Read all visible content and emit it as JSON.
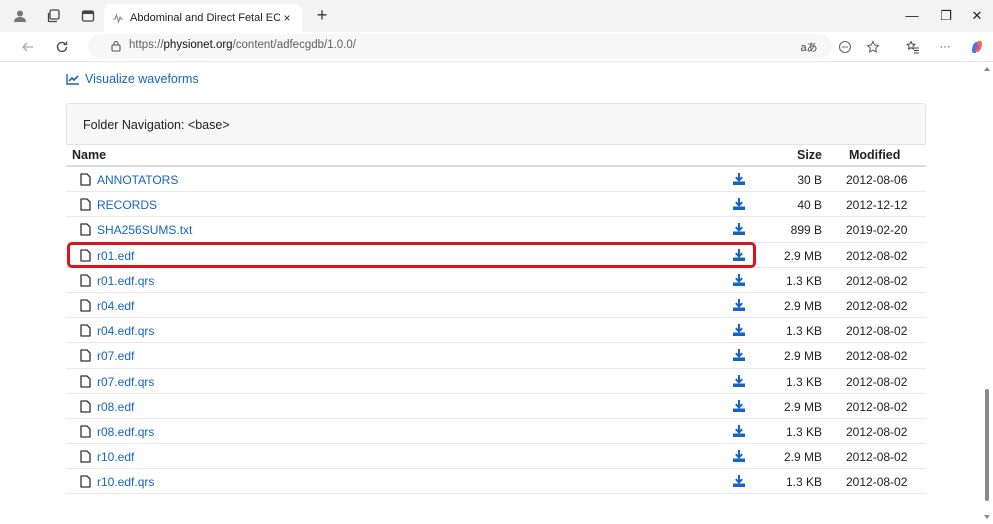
{
  "browser": {
    "tab_title": "Abdominal and Direct Fetal ECG D",
    "tab_close": "×",
    "new_tab": "+",
    "url_prefix": "https://",
    "url_host": "physionet.org",
    "url_path": "/content/adfecgdb/1.0.0/",
    "read_aloud": "aあ",
    "more": "···",
    "win_min": "—",
    "win_restore": "❐",
    "win_close": "✕"
  },
  "page": {
    "visualize_link": "Visualize waveforms",
    "folder_nav": "Folder Navigation: <base>",
    "columns": {
      "name": "Name",
      "size": "Size",
      "modified": "Modified"
    },
    "files": [
      {
        "name": "ANNOTATORS",
        "size": "30 B",
        "modified": "2012-08-06"
      },
      {
        "name": "RECORDS",
        "size": "40 B",
        "modified": "2012-12-12"
      },
      {
        "name": "SHA256SUMS.txt",
        "size": "899 B",
        "modified": "2019-02-20"
      },
      {
        "name": "r01.edf",
        "size": "2.9 MB",
        "modified": "2012-08-02"
      },
      {
        "name": "r01.edf.qrs",
        "size": "1.3 KB",
        "modified": "2012-08-02"
      },
      {
        "name": "r04.edf",
        "size": "2.9 MB",
        "modified": "2012-08-02"
      },
      {
        "name": "r04.edf.qrs",
        "size": "1.3 KB",
        "modified": "2012-08-02"
      },
      {
        "name": "r07.edf",
        "size": "2.9 MB",
        "modified": "2012-08-02"
      },
      {
        "name": "r07.edf.qrs",
        "size": "1.3 KB",
        "modified": "2012-08-02"
      },
      {
        "name": "r08.edf",
        "size": "2.9 MB",
        "modified": "2012-08-02"
      },
      {
        "name": "r08.edf.qrs",
        "size": "1.3 KB",
        "modified": "2012-08-02"
      },
      {
        "name": "r10.edf",
        "size": "2.9 MB",
        "modified": "2012-08-02"
      },
      {
        "name": "r10.edf.qrs",
        "size": "1.3 KB",
        "modified": "2012-08-02"
      }
    ]
  },
  "colors": {
    "link": "#1565c0",
    "highlight": "#e0111b"
  }
}
